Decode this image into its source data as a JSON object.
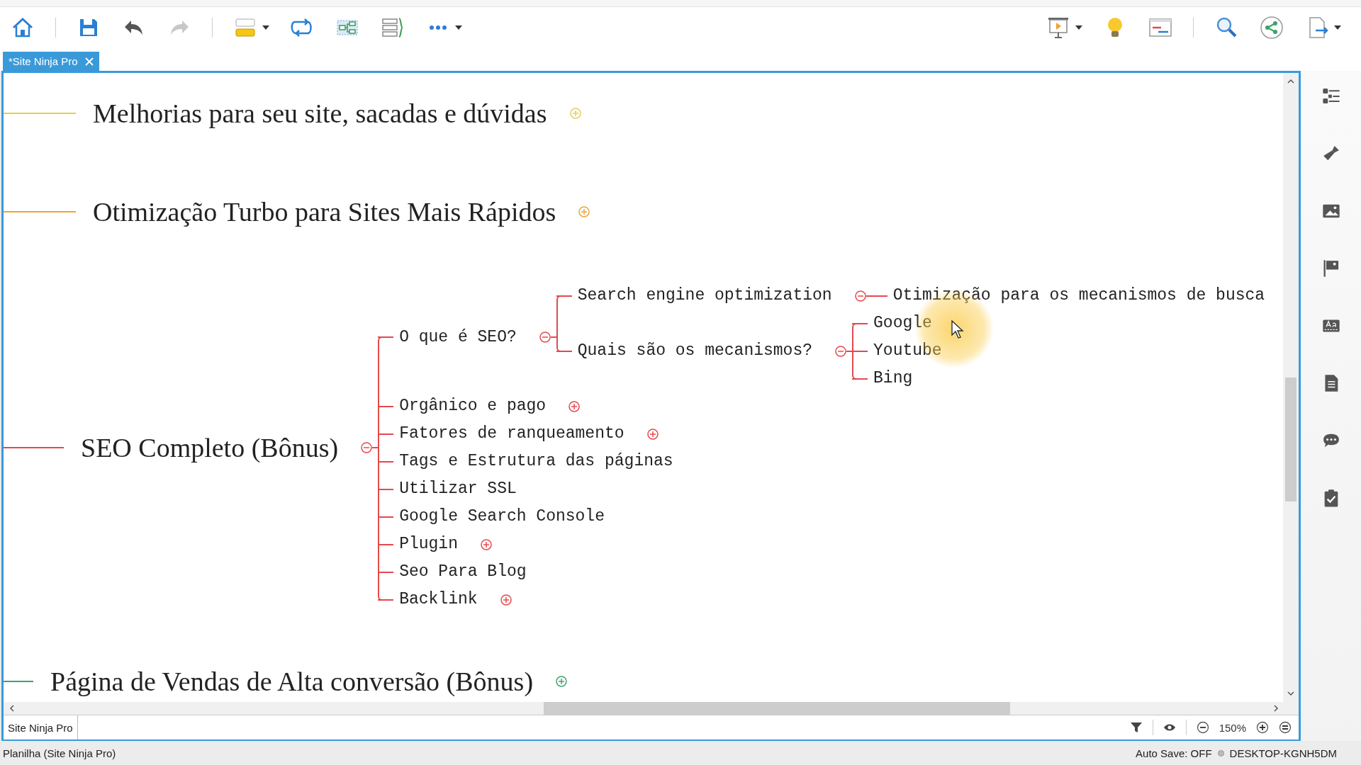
{
  "toolbar": {
    "undo": {
      "disabled": false
    },
    "redo": {
      "disabled": true
    }
  },
  "document_tab": {
    "title": "*Site Ninja Pro",
    "selected": true
  },
  "mind_map": {
    "topics": [
      {
        "text": "Melhorias para seu site, sacadas e dúvidas",
        "color": "#e6cf4a",
        "expanded": false
      },
      {
        "text": "Otimização Turbo para Sites Mais Rápidos",
        "color": "#f0a236",
        "expanded": false
      },
      {
        "text": "SEO Completo (Bônus)",
        "color": "#e5484d",
        "expanded": true,
        "children": [
          {
            "text": "O que é SEO?",
            "expanded": true,
            "children": [
              {
                "text": "Search engine optimization",
                "expanded": true,
                "children": [
                  {
                    "text": "Otimização para os mecanismos de busca"
                  }
                ]
              },
              {
                "text": "Quais são os mecanismos?",
                "expanded": true,
                "children": [
                  {
                    "text": "Google"
                  },
                  {
                    "text": "Youtube"
                  },
                  {
                    "text": "Bing"
                  }
                ]
              }
            ]
          },
          {
            "text": "Orgânico e pago",
            "expanded": false
          },
          {
            "text": "Fatores de ranqueamento",
            "expanded": false
          },
          {
            "text": "Tags e Estrutura das páginas"
          },
          {
            "text": "Utilizar SSL"
          },
          {
            "text": "Google Search Console"
          },
          {
            "text": "Plugin",
            "expanded": false
          },
          {
            "text": "Seo Para Blog"
          },
          {
            "text": "Backlink",
            "expanded": false
          }
        ]
      },
      {
        "text": "Página de Vendas de Alta conversão (Bônus)",
        "color": "#3aa36a",
        "expanded": false
      }
    ]
  },
  "sheet_tabs": [
    {
      "label": "Site Ninja Pro",
      "selected": true
    }
  ],
  "zoom": "150%",
  "status_bar": {
    "sheet": "Planilha (Site Ninja Pro)",
    "auto_save": "Auto Save: OFF",
    "computer": "DESKTOP-KGNH5DM"
  }
}
